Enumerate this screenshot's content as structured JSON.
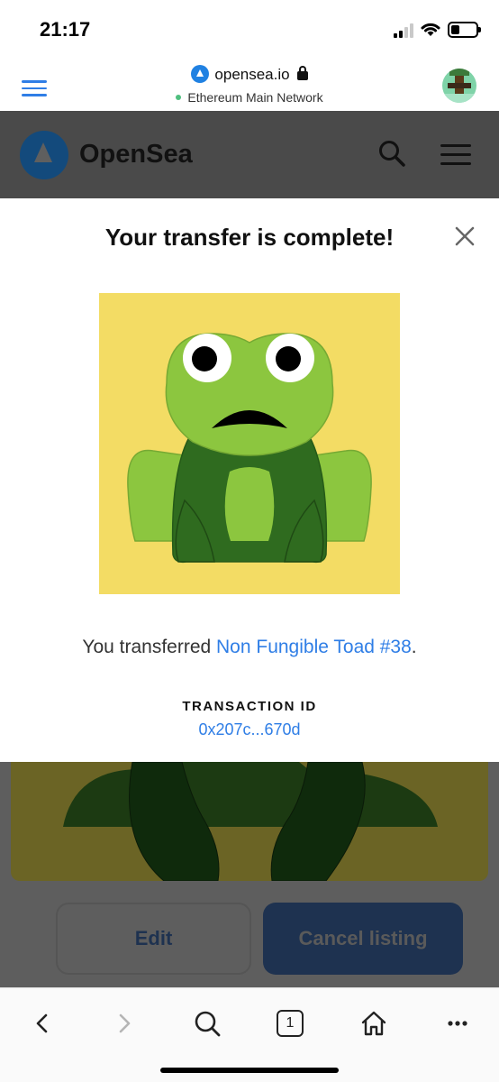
{
  "status_bar": {
    "time": "21:17"
  },
  "browser": {
    "domain": "opensea.io",
    "network": "Ethereum Main Network"
  },
  "background_page": {
    "brand": "OpenSea",
    "edit_label": "Edit",
    "cancel_label": "Cancel listing"
  },
  "modal": {
    "title": "Your transfer is complete!",
    "transfer_prefix": "You transferred ",
    "nft_name": "Non Fungible Toad #38",
    "transfer_suffix": ".",
    "tx_label": "TRANSACTION ID",
    "tx_id": "0x207c...670d"
  },
  "tabs": {
    "count": "1"
  },
  "colors": {
    "accent": "#2f7ee6",
    "nft_background": "#f3dc64",
    "toad_light": "#8cc63f",
    "toad_dark": "#2f6b1f",
    "opensea_blue": "#2081e2"
  },
  "icons": {
    "menu": "hamburger-icon",
    "site": "opensea-logo-icon",
    "secure": "lock-icon",
    "close": "close-icon",
    "back": "chevron-left-icon",
    "forward": "chevron-right-icon",
    "search": "search-icon",
    "tabs": "tabs-icon",
    "home": "home-icon",
    "more": "more-icon"
  }
}
